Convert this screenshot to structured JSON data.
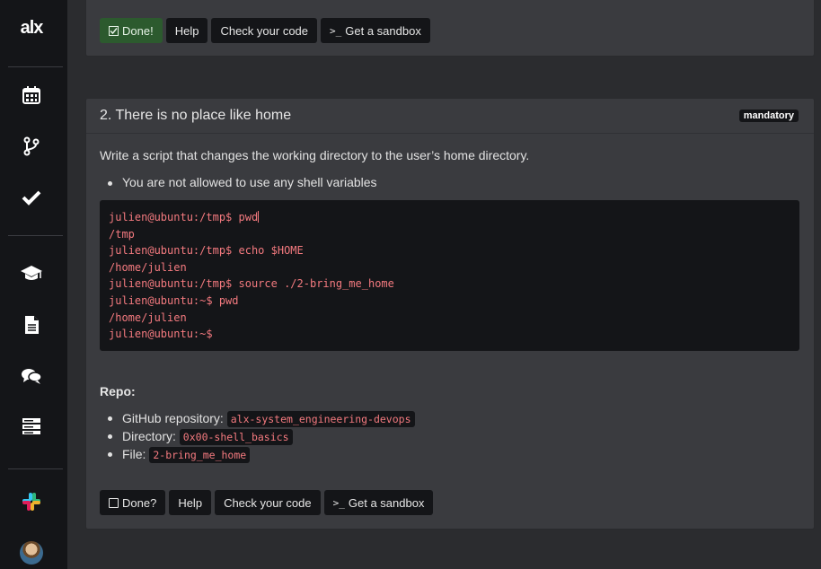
{
  "sidebar": {
    "logo": "alx",
    "items": [
      {
        "icon": "calendar-icon"
      },
      {
        "icon": "git-branch-icon"
      },
      {
        "icon": "checkmark-icon"
      },
      {
        "icon": "graduation-cap-icon"
      },
      {
        "icon": "document-icon"
      },
      {
        "icon": "chat-bubbles-icon"
      },
      {
        "icon": "server-list-icon"
      },
      {
        "icon": "slack-icon"
      }
    ]
  },
  "top_panel": {
    "buttons": {
      "done": "Done!",
      "help": "Help",
      "check": "Check your code",
      "sandbox": "Get a sandbox"
    }
  },
  "task": {
    "title": "2. There is no place like home",
    "badge": "mandatory",
    "description": "Write a script that changes the working directory to the user’s home directory.",
    "rules": [
      "You are not allowed to use any shell variables"
    ],
    "terminal": [
      "julien@ubuntu:/tmp$ pwd",
      "/tmp",
      "julien@ubuntu:/tmp$ echo $HOME",
      "/home/julien",
      "julien@ubuntu:/tmp$ source ./2-bring_me_home",
      "julien@ubuntu:~$ pwd",
      "/home/julien",
      "julien@ubuntu:~$"
    ],
    "repo_label": "Repo:",
    "repo": {
      "github_label": "GitHub repository:",
      "github_value": "alx-system_engineering-devops",
      "directory_label": "Directory:",
      "directory_value": "0x00-shell_basics",
      "file_label": "File:",
      "file_value": "2-bring_me_home"
    },
    "buttons": {
      "done": "Done?",
      "help": "Help",
      "check": "Check your code",
      "sandbox": "Get a sandbox"
    }
  },
  "colors": {
    "background": "#2b2c2f",
    "panel": "#3a3b3f",
    "sidebar": "#141518",
    "done_green": "#2c5a2e",
    "code_red": "#f47a7f"
  }
}
